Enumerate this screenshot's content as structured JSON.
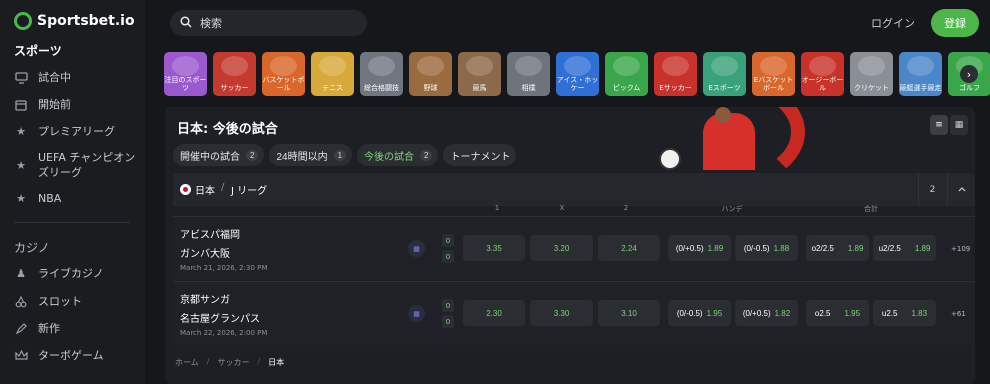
{
  "brand": {
    "name": "Sportsbet.io",
    "accent": "#4cb748"
  },
  "sidebar": {
    "sports_heading": "スポーツ",
    "sports_items": [
      {
        "label": "試合中",
        "icon": "monitor-icon"
      },
      {
        "label": "開始前",
        "icon": "calendar-icon"
      },
      {
        "label": "プレミアリーグ",
        "icon": "star-icon"
      },
      {
        "label": "UEFA チャンピオンズリーグ",
        "icon": "star-icon"
      },
      {
        "label": "NBA",
        "icon": "star-icon"
      }
    ],
    "casino_heading": "カジノ",
    "casino_items": [
      {
        "label": "ライブカジノ",
        "icon": "chess-pawn-icon"
      },
      {
        "label": "スロット",
        "icon": "cherries-icon"
      },
      {
        "label": "新作",
        "icon": "rocket-icon"
      },
      {
        "label": "ターボゲーム",
        "icon": "crown-icon"
      }
    ]
  },
  "header": {
    "search_placeholder": "検索",
    "login_label": "ログイン",
    "register_label": "登録"
  },
  "sport_tiles": [
    {
      "label": "注目のスポーツ",
      "color": "#9b59d0"
    },
    {
      "label": "サッカー",
      "color": "#c43a2f"
    },
    {
      "label": "バスケットボール",
      "color": "#d9662a"
    },
    {
      "label": "テニス",
      "color": "#d7a93a"
    },
    {
      "label": "総合格闘技",
      "color": "#6f7680"
    },
    {
      "label": "野球",
      "color": "#9a6b3e"
    },
    {
      "label": "競馬",
      "color": "#8a6a4a"
    },
    {
      "label": "相撲",
      "color": "#6e747c"
    },
    {
      "label": "アイス・ホッケー",
      "color": "#2f6fd6"
    },
    {
      "label": "ピックム",
      "color": "#3aa64a"
    },
    {
      "label": "Eサッカー",
      "color": "#c8322b"
    },
    {
      "label": "Eスポーツ",
      "color": "#3aa27a"
    },
    {
      "label": "Eバスケットボール",
      "color": "#d9662a"
    },
    {
      "label": "オージーボール",
      "color": "#c8322b"
    },
    {
      "label": "クリケット",
      "color": "#8a8f96"
    },
    {
      "label": "競艇選手競走",
      "color": "#4a86c8"
    },
    {
      "label": "ゴルフ",
      "color": "#3aa64a"
    }
  ],
  "panel": {
    "title": "日本: 今後の試合",
    "filters": [
      {
        "label": "開催中の試合",
        "count": "2"
      },
      {
        "label": "24時間以内",
        "count": "1"
      },
      {
        "label": "今後の試合",
        "count": "2"
      },
      {
        "label": "トーナメント",
        "count": ""
      }
    ],
    "league": {
      "country": "日本",
      "separator": "/",
      "name": "J リーグ",
      "count": "2"
    },
    "columns": {
      "one": "1",
      "x": "X",
      "two": "2",
      "handicap": "ハンデ",
      "total": "合計"
    },
    "matches": [
      {
        "home": "アビスパ福岡",
        "away": "ガンバ大阪",
        "date": "March 21, 2026, 2:30 PM",
        "score_home": "0",
        "score_away": "0",
        "odds_1": "3.35",
        "odds_x": "3.20",
        "odds_2": "2.24",
        "hcp_home_line": "(0/+0.5)",
        "hcp_home_odds": "1.89",
        "hcp_away_line": "(0/-0.5)",
        "hcp_away_odds": "1.88",
        "over_line": "o2/2.5",
        "over_odds": "1.89",
        "under_line": "u2/2.5",
        "under_odds": "1.89",
        "more": "+109"
      },
      {
        "home": "京都サンガ",
        "away": "名古屋グランパス",
        "date": "March 22, 2026, 2:00 PM",
        "score_home": "0",
        "score_away": "0",
        "odds_1": "2.30",
        "odds_x": "3.30",
        "odds_2": "3.10",
        "hcp_home_line": "(0/-0.5)",
        "hcp_home_odds": "1.95",
        "hcp_away_line": "(0/+0.5)",
        "hcp_away_odds": "1.82",
        "over_line": "o2.5",
        "over_odds": "1.95",
        "under_line": "u2.5",
        "under_odds": "1.83",
        "more": "+61"
      }
    ],
    "breadcrumb": [
      "ホーム",
      "サッカー",
      "日本"
    ]
  }
}
